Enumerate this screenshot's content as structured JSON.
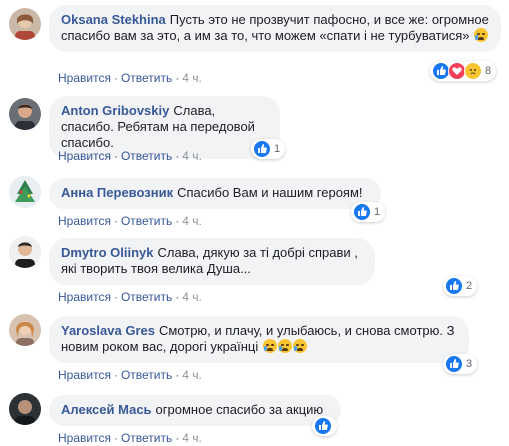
{
  "colors": {
    "author": "#385898",
    "bubble": "#f2f3f5",
    "like": "#1877f2",
    "love": "#f33e58",
    "meta": "#90949c"
  },
  "comments": [
    {
      "author": "Oksana Stekhina",
      "text": "Пусть это не прозвучит пафосно, и все же: огромное спасибо вам за это, а им за то, что можем «спати і не турбуватися»",
      "emoji": [
        "crying-face"
      ],
      "like_label": "Нравится",
      "reply_label": "Ответить",
      "time": "4 ч.",
      "reactions": [
        "like",
        "love",
        "sad"
      ],
      "reaction_count": "8"
    },
    {
      "author": "Anton Gribovskiy",
      "text": "Слава, спасибо. Ребятам на передовой спасибо.",
      "emoji": [],
      "like_label": "Нравится",
      "reply_label": "Ответить",
      "time": "4 ч.",
      "reactions": [
        "like"
      ],
      "reaction_count": "1"
    },
    {
      "author": "Анна Перевозник",
      "text": "Спасибо Вам и нашим героям!",
      "emoji": [],
      "like_label": "Нравится",
      "reply_label": "Ответить",
      "time": "4 ч.",
      "reactions": [
        "like"
      ],
      "reaction_count": "1"
    },
    {
      "author": "Dmytro Oliinyk",
      "text": "Слава, дякую за ті добрі справи , які творить твоя велика Душа...",
      "emoji": [],
      "like_label": "Нравится",
      "reply_label": "Ответить",
      "time": "4 ч.",
      "reactions": [
        "like"
      ],
      "reaction_count": "2"
    },
    {
      "author": "Yaroslava Gres",
      "text": "Смотрю, и плачу, и улыбаюсь, и снова смотрю. З новим роком вас, дорогі українці",
      "emoji": [
        "crying-face",
        "crying-face",
        "crying-face"
      ],
      "like_label": "Нравится",
      "reply_label": "Ответить",
      "time": "4 ч.",
      "reactions": [
        "like"
      ],
      "reaction_count": "3"
    },
    {
      "author": "Алексей Мась",
      "text": "огромное спасибо за акцию",
      "emoji": [],
      "like_label": "Нравится",
      "reply_label": "Ответить",
      "time": "4 ч.",
      "reactions": [
        "like"
      ],
      "reaction_count": ""
    }
  ]
}
